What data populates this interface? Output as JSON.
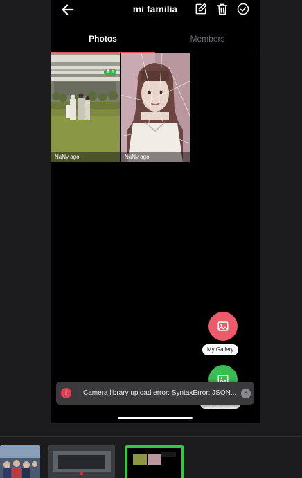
{
  "header": {
    "title": "mi familia",
    "icons": [
      "back-arrow-icon",
      "edit-icon",
      "trash-icon",
      "check-circle-icon"
    ]
  },
  "tabs": [
    {
      "label": "Photos",
      "active": true
    },
    {
      "label": "Members",
      "active": false
    }
  ],
  "photos": [
    {
      "caption": "NaNy ago",
      "badge": "1",
      "badge_icon": "upload-arrow-icon"
    },
    {
      "caption": "NaNy ago"
    }
  ],
  "fabs": {
    "gallery_label": "My Gallery",
    "camera_label": "Camera Roll"
  },
  "toast": {
    "message": "Camera library upload error: SyntaxError: JSON...",
    "icon": "error-icon",
    "close_icon": "close-icon"
  },
  "colors": {
    "accent": "#e05561",
    "gallery_fab": "#ec5a6c",
    "camera_fab": "#3cba54",
    "badge": "#37b24d",
    "selected_thumb_border": "#2ecc40"
  }
}
